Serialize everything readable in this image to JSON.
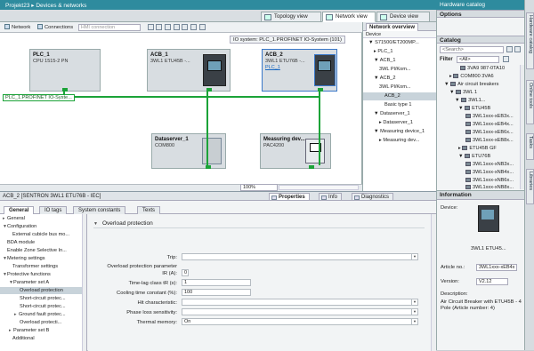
{
  "app": {
    "title": "Projekt23 ▸ Devices & networks",
    "hc_title": "Hardware catalog"
  },
  "views": {
    "topology": "Topology view",
    "network": "Network view",
    "device": "Device view"
  },
  "toolbar": {
    "network": "Network",
    "connections": "Connections",
    "hmi_placeholder": "HMI connection"
  },
  "io_system": "IO system: PLC_1.PROFINET IO-System (101)",
  "devices": {
    "plc1": {
      "name": "PLC_1",
      "type": "CPU 1515-2 PN"
    },
    "acb1": {
      "name": "ACB_1",
      "type": "3WL1 ETU45B -..."
    },
    "acb2": {
      "name": "ACB_2",
      "type": "3WL1 ETU76B -...",
      "link": "PLC_1"
    },
    "ds1": {
      "name": "Dataserver_1",
      "type": "COM800"
    },
    "md": {
      "name": "Measuring dev...",
      "type": "PAC4200"
    }
  },
  "profinet_label": "PLC_1.PROFINET IO-Syste...",
  "zoom": "100%",
  "overview": {
    "tab": "Network overview",
    "col": "Device",
    "rows": [
      "S71500/ET200MP...",
      "PLC_1",
      "ACB_1",
      "3WL Pl/Kom...",
      "ACB_2",
      "3WL Pl/Kom...",
      "ACB_2",
      "Basic type 1",
      "Dataserver_1",
      "Dataserver_1",
      "Measuring device_1",
      "Measuring dev..."
    ]
  },
  "options_title": "Options",
  "catalog": {
    "title": "Catalog",
    "search": "<Search>",
    "filter": "Filter",
    "filter_value": "<All>",
    "items": [
      "3VA9 987-0TA10",
      "COM800 3VA6",
      "Air circuit breakers",
      "3WL 1",
      "3WL1...",
      "ETU45B",
      "3WL1xxx-xEB3x...",
      "3WL1xxx-xEB4x...",
      "3WL1xxx-xEB6x...",
      "3WL1xxx-xEB8x...",
      "ETU45B GF",
      "ETU76B",
      "3WL1xxx-xNB3x...",
      "3WL1xxx-xNB4x...",
      "3WL1xxx-xNB6x...",
      "3WL1xxx-xNB8x..."
    ]
  },
  "information": {
    "title": "Information",
    "device_label": "Device:",
    "device_name": "3WL1 ETU45...",
    "article_label": "Article no.:",
    "article_value": "3WL1xxx-xEB4x",
    "version_label": "Version:",
    "version_value": "V2.12",
    "description_label": "Description:",
    "description": "Air Circuit Breaker with ETU45B - 4 Pole (Article number: 4)"
  },
  "vtabs": [
    "Hardware catalog",
    "Online tools",
    "Tasks",
    "Libraries"
  ],
  "props": {
    "title": "ACB_2 [SENTRON 3WL1 ETU76B - IEC]",
    "tabs": {
      "properties": "Properties",
      "info": "Info",
      "diagnostics": "Diagnostics"
    },
    "subtabs": [
      "General",
      "IO tags",
      "System constants",
      "Texts"
    ],
    "nav": [
      "General",
      "Configuration",
      "External cubicle bus mo...",
      "BDA module",
      "Enable Zone Selective In...",
      "Metering settings",
      "Transformer settings",
      "Protective functions",
      "Parameter set A",
      "Overload protection",
      "Short-circuit protec...",
      "Short-circuit protec...",
      "Ground fault protec...",
      "Overload protecti...",
      "Parameter set B",
      "Additional"
    ],
    "section": "Overload protection",
    "fields": {
      "trip_label": "Trip:",
      "param_label": "Overload protection parameter",
      "ir_label": "IR (A):",
      "ir_value": "0",
      "tr_label": "Time-lag class tR (s):",
      "tr_value": "1",
      "cool_label": "Cooling time constant (%):",
      "cool_value": "100",
      "hit_label": "Hit characteristic:",
      "phase_label": "Phase loss sensitivity:",
      "thermal_label": "Thermal memory:",
      "thermal_value": "On"
    }
  },
  "colors": {
    "accent": "#2e8b9e",
    "profinet": "#1ba338"
  }
}
